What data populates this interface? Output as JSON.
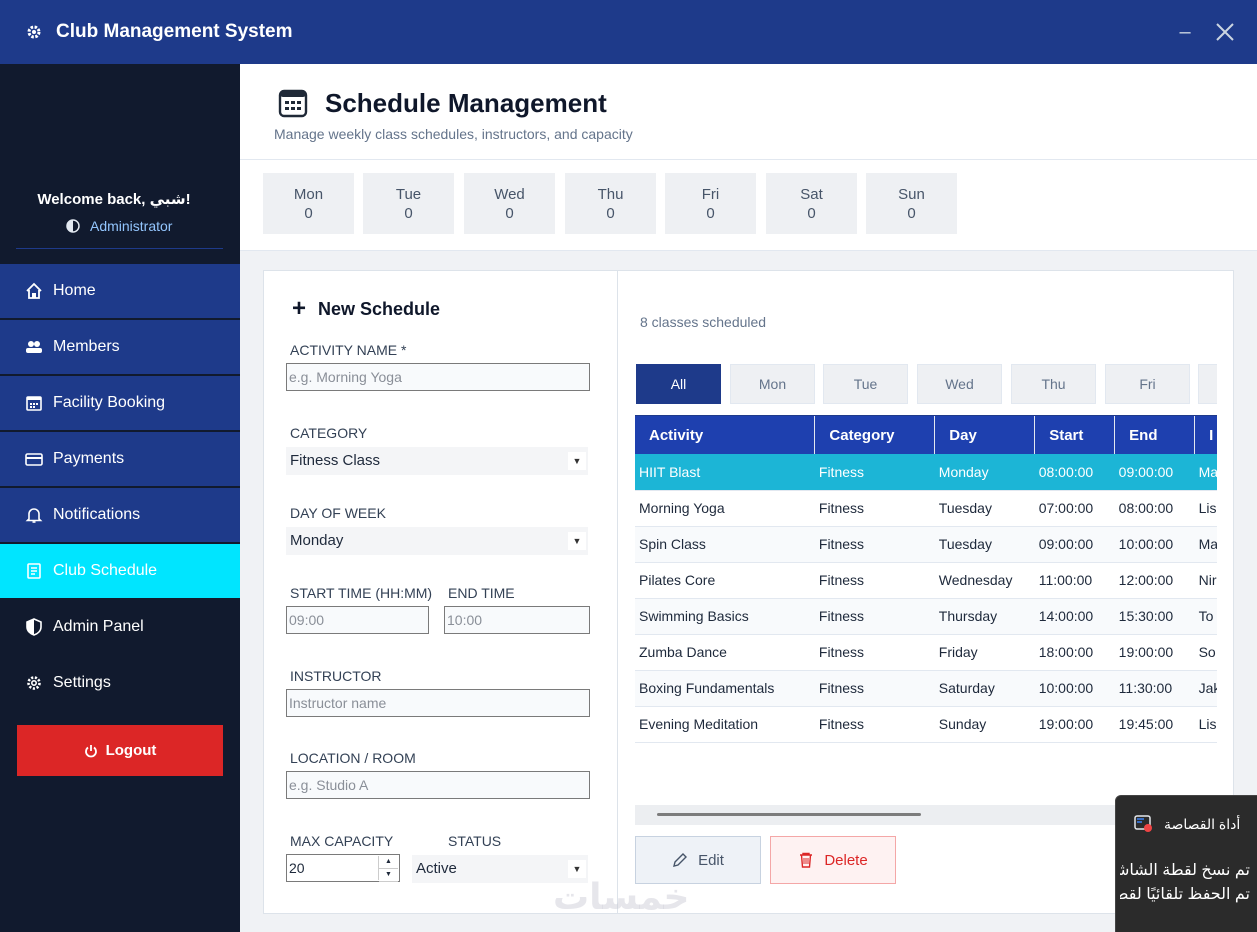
{
  "app": {
    "title": "Club Management System",
    "minimize_label": "–",
    "close_label": "✕"
  },
  "sidebar": {
    "welcome": "Welcome back, شبي!",
    "role": "Administrator",
    "items": [
      {
        "label": "Home",
        "icon": "home-icon"
      },
      {
        "label": "Members",
        "icon": "members-icon"
      },
      {
        "label": "Facility Booking",
        "icon": "calendar-icon"
      },
      {
        "label": "Payments",
        "icon": "card-icon"
      },
      {
        "label": "Notifications",
        "icon": "bell-icon"
      },
      {
        "label": "Club Schedule",
        "icon": "schedule-icon",
        "active": true
      },
      {
        "label": "Admin Panel",
        "icon": "shield-icon"
      },
      {
        "label": "Settings",
        "icon": "gear-icon"
      }
    ],
    "logout_label": "Logout"
  },
  "header": {
    "title": "Schedule Management",
    "subtitle": "Manage weekly class schedules, instructors, and capacity"
  },
  "day_summary": [
    {
      "day": "Mon",
      "count": "0"
    },
    {
      "day": "Tue",
      "count": "0"
    },
    {
      "day": "Wed",
      "count": "0"
    },
    {
      "day": "Thu",
      "count": "0"
    },
    {
      "day": "Fri",
      "count": "0"
    },
    {
      "day": "Sat",
      "count": "0"
    },
    {
      "day": "Sun",
      "count": "0"
    }
  ],
  "form": {
    "title": "New Schedule",
    "activity_label": "ACTIVITY NAME *",
    "activity_placeholder": "e.g. Morning Yoga",
    "category_label": "CATEGORY",
    "category_value": "Fitness Class",
    "day_label": "DAY OF WEEK",
    "day_value": "Monday",
    "start_label": "START TIME (HH:MM)",
    "start_placeholder": "09:00",
    "end_label": "END TIME",
    "end_placeholder": "10:00",
    "instructor_label": "INSTRUCTOR",
    "instructor_placeholder": "Instructor name",
    "location_label": "LOCATION / ROOM",
    "location_placeholder": "e.g. Studio A",
    "capacity_label": "MAX CAPACITY",
    "capacity_value": "20",
    "status_label": "STATUS",
    "status_value": "Active"
  },
  "list": {
    "count_text": "8 classes scheduled",
    "filter_tabs": [
      "All",
      "Mon",
      "Tue",
      "Wed",
      "Thu",
      "Fri"
    ],
    "columns": [
      "Activity",
      "Category",
      "Day",
      "Start",
      "End",
      "I"
    ],
    "rows": [
      [
        "HIIT Blast",
        "Fitness",
        "Monday",
        "08:00:00",
        "09:00:00",
        "Ma"
      ],
      [
        "Morning Yoga",
        "Fitness",
        "Tuesday",
        "07:00:00",
        "08:00:00",
        "Lis"
      ],
      [
        "Spin Class",
        "Fitness",
        "Tuesday",
        "09:00:00",
        "10:00:00",
        "Ma"
      ],
      [
        "Pilates Core",
        "Fitness",
        "Wednesday",
        "11:00:00",
        "12:00:00",
        "Nir"
      ],
      [
        "Swimming Basics",
        "Fitness",
        "Thursday",
        "14:00:00",
        "15:30:00",
        "To"
      ],
      [
        "Zumba Dance",
        "Fitness",
        "Friday",
        "18:00:00",
        "19:00:00",
        "So"
      ],
      [
        "Boxing Fundamentals",
        "Fitness",
        "Saturday",
        "10:00:00",
        "11:30:00",
        "Jak"
      ],
      [
        "Evening Meditation",
        "Fitness",
        "Sunday",
        "19:00:00",
        "19:45:00",
        "Lis"
      ]
    ],
    "edit_label": "Edit",
    "delete_label": "Delete"
  },
  "toast": {
    "title": "أداة القصاصة",
    "line1": "تم نسخ لقطة الشاشة إلى الحافظة.",
    "line2": "تم الحفظ تلقائيًا لقطات الشاشة."
  },
  "watermark": "خمسات",
  "colors": {
    "primary": "#1e3a8a",
    "sidebar_bg": "#111a2e",
    "active": "#00e5ff",
    "danger": "#dc2626",
    "selected_row": "#1cb5d6"
  }
}
